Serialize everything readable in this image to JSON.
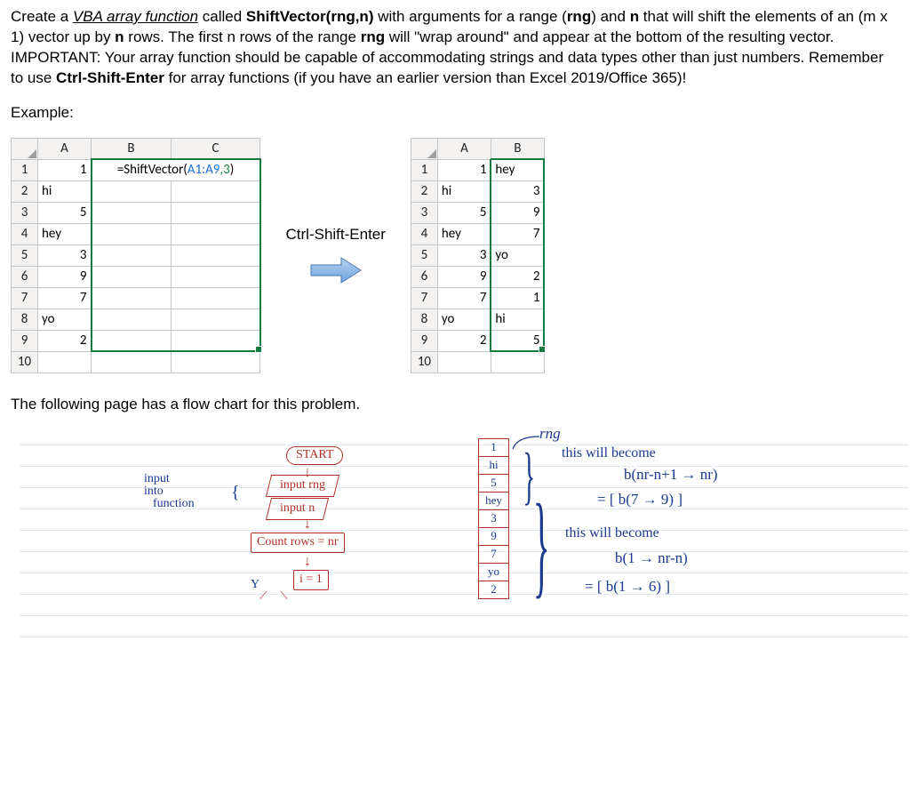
{
  "instructions": {
    "p1_a": "Create a ",
    "vba_fn": "VBA array function",
    "p1_b": " called ",
    "fn_name": "ShiftVector(rng,n)",
    "p1_c": " with arguments for a range (",
    "rng": "rng",
    "p1_d": ") and ",
    "nvar": "n",
    "p1_e": " that will shift the elements of an (m x 1) vector up by ",
    "nvar2": "n",
    "p1_f": " rows.  The first n rows of the range ",
    "rng2": "rng",
    "p1_g": " will \"wrap around\" and appear at the bottom of the resulting vector.  IMPORTANT: Your array function should be capable of accommodating strings and data types other than just numbers.  Remember to use ",
    "cse": "Ctrl-Shift-Enter",
    "p1_h": " for array functions (if you have an earlier version than Excel 2019/Office 365)!"
  },
  "labels": {
    "example": "Example:",
    "cse_label": "Ctrl-Shift-Enter",
    "below_note": "The following page has a flow chart for this problem."
  },
  "sheet1": {
    "cols": [
      "A",
      "B",
      "C"
    ],
    "formula_eq": "=ShiftVector(",
    "formula_ref": "A1:A9",
    "formula_num": ",3",
    "formula_end": ")",
    "rows": [
      {
        "n": "1",
        "a": "1",
        "b": "FORMULA"
      },
      {
        "n": "2",
        "a": "hi"
      },
      {
        "n": "3",
        "a": "5"
      },
      {
        "n": "4",
        "a": "hey"
      },
      {
        "n": "5",
        "a": "3"
      },
      {
        "n": "6",
        "a": "9"
      },
      {
        "n": "7",
        "a": "7"
      },
      {
        "n": "8",
        "a": "yo"
      },
      {
        "n": "9",
        "a": "2"
      },
      {
        "n": "10",
        "a": ""
      }
    ]
  },
  "sheet2": {
    "cols": [
      "A",
      "B"
    ],
    "rows": [
      {
        "n": "1",
        "a": "1",
        "b": "hey"
      },
      {
        "n": "2",
        "a": "hi",
        "b": "3"
      },
      {
        "n": "3",
        "a": "5",
        "b": "9"
      },
      {
        "n": "4",
        "a": "hey",
        "b": "7"
      },
      {
        "n": "5",
        "a": "3",
        "b": "yo"
      },
      {
        "n": "6",
        "a": "9",
        "b": "2"
      },
      {
        "n": "7",
        "a": "7",
        "b": "1"
      },
      {
        "n": "8",
        "a": "yo",
        "b": "hi"
      },
      {
        "n": "9",
        "a": "2",
        "b": "5"
      },
      {
        "n": "10",
        "a": "",
        "b": ""
      }
    ]
  },
  "sketch": {
    "start": "START",
    "input_into": "input into function",
    "input_rng": "input rng",
    "input_n": "input n",
    "count_rows": "Count rows = nr",
    "i_eq_1": "i = 1",
    "y_label": "Y",
    "rng_label": "rng",
    "mini_list": [
      "1",
      "hi",
      "5",
      "hey",
      "3",
      "9",
      "7",
      "yo",
      "2"
    ],
    "note1a": "this will become",
    "note1b": "b(nr-n+1 → nr)",
    "note1c": "= [ b(7 → 9) ]",
    "note2a": "this will become",
    "note2b": "b(1 → nr-n)",
    "note2c": "= [ b(1 → 6) ]"
  }
}
